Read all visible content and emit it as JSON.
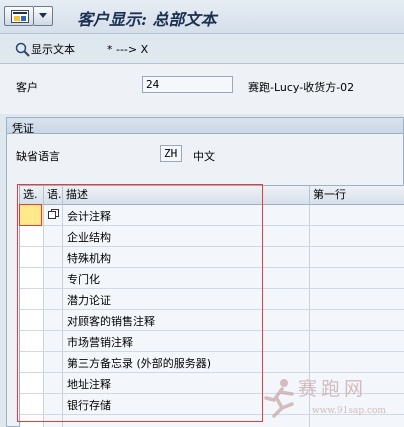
{
  "window": {
    "title": "客户显示: 总部文本"
  },
  "toolbar": {
    "display_text_label": "显示文本",
    "arrow_label": "* ---> X"
  },
  "customer": {
    "label": "客户",
    "value": "24",
    "name": "赛跑-Lucy-收货方-02"
  },
  "voucher": {
    "group_title": "凭证",
    "default_lang_label": "缺省语言",
    "default_lang_code": "ZH",
    "default_lang_name": "中文"
  },
  "table": {
    "headers": {
      "select": "选.",
      "lang": "语.",
      "desc": "描述",
      "first_line": "第一行"
    },
    "rows": [
      {
        "desc": "会计注释"
      },
      {
        "desc": "企业结构"
      },
      {
        "desc": "特殊机构"
      },
      {
        "desc": "专门化"
      },
      {
        "desc": "潜力论证"
      },
      {
        "desc": "对顾客的销售注释"
      },
      {
        "desc": "市场营销注释"
      },
      {
        "desc": "第三方备忘录 (外部的服务器)"
      },
      {
        "desc": "地址注释"
      },
      {
        "desc": "银行存储"
      }
    ]
  },
  "watermark": {
    "main": "赛跑网",
    "url": "www.91sap.com"
  },
  "colors": {
    "highlight": "#e53d3d",
    "selected_cell": "#ffe98a"
  }
}
